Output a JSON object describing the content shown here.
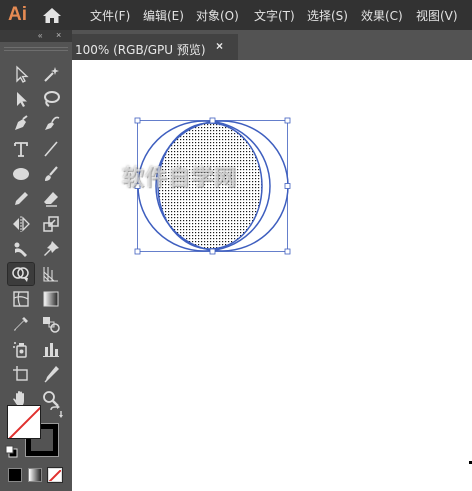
{
  "app": {
    "logo_text": "Ai",
    "home_icon": "home-icon",
    "brand_color": "#E58A53"
  },
  "menu": {
    "items": [
      "文件(F)",
      "编辑(E)",
      "对象(O)",
      "文字(T)",
      "选择(S)",
      "效果(C)",
      "视图(V)"
    ]
  },
  "tools_panel": {
    "collapse_icon": "«",
    "close_icon": "×",
    "tools": [
      "selection-tool",
      "magic-wand-tool",
      "direct-selection-tool",
      "lasso-tool",
      "pen-tool",
      "curvature-tool",
      "type-tool",
      "line-segment-tool",
      "ellipse-tool",
      "paintbrush-tool",
      "pencil-tool",
      "eraser-tool",
      "reflect-tool",
      "scale-tool",
      "puppet-warp-tool",
      "pin-tool",
      "shape-builder-tool",
      "perspective-grid-tool",
      "mesh-tool",
      "gradient-tool",
      "eyedropper-tool",
      "blend-tool",
      "symbol-sprayer-tool",
      "column-graph-tool",
      "artboard-tool",
      "slice-tool",
      "hand-tool",
      "zoom-tool"
    ],
    "active_tool": "shape-builder-tool"
  },
  "colors": {
    "fill": "#FFFFFF",
    "stroke": "#000000",
    "none_slash": "#E0302E",
    "selection_blue": "#3F5FBF"
  },
  "document": {
    "tab_label": "100% (RGB/GPU 预览)",
    "close_label": "×"
  },
  "canvas": {
    "watermark": "软件自学网"
  }
}
